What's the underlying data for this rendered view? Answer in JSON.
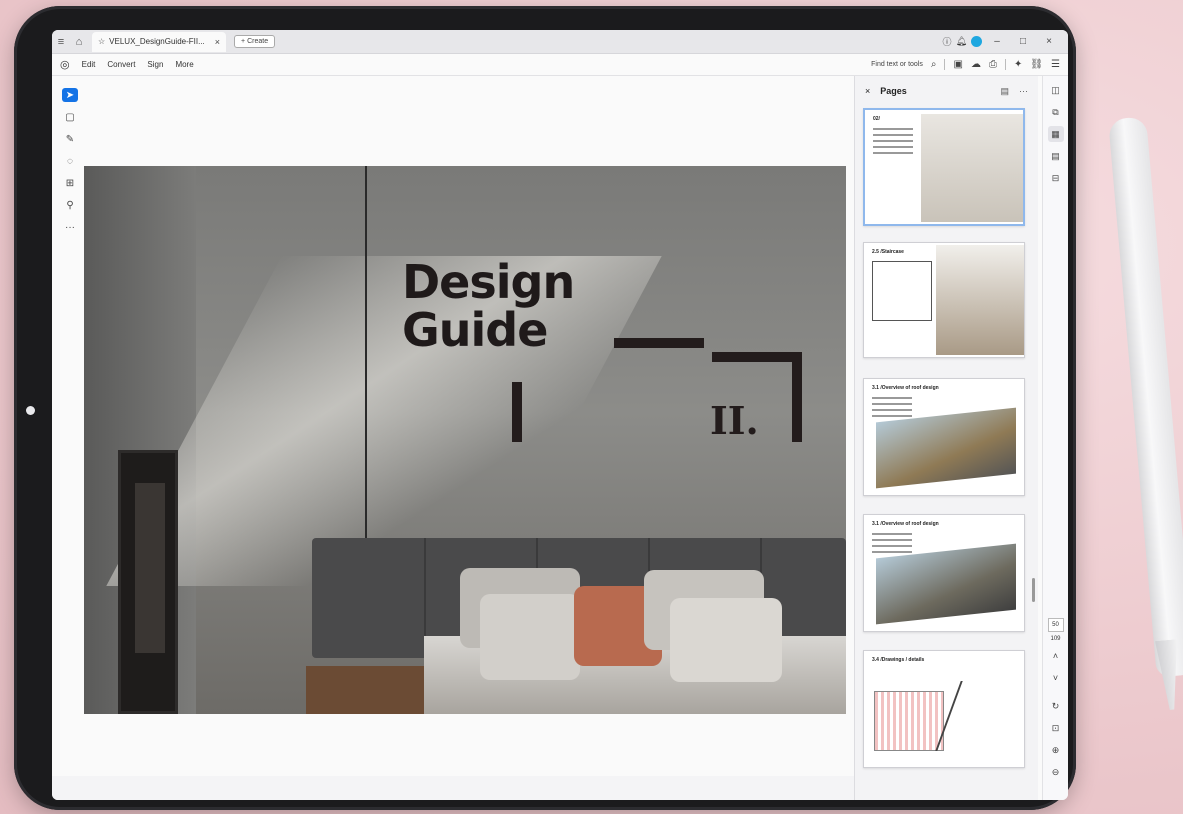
{
  "tabbar": {
    "tab_title": "VELUX_DesignGuide-FII...",
    "close_glyph": "×",
    "create_label": "+ Create",
    "window_controls": [
      "–",
      "□",
      "×"
    ]
  },
  "menubar": {
    "items": [
      "Edit",
      "Convert",
      "Sign",
      "More"
    ],
    "find_placeholder": "Find text or tools"
  },
  "document": {
    "heading_line1": "Design",
    "heading_line2": "Guide",
    "roman_numeral": "II."
  },
  "pages_panel": {
    "title": "Pages",
    "close_glyph": "×",
    "more_glyph": "···",
    "thumbnails": [
      {
        "title": "02/",
        "accent": "#2b2b2b"
      },
      {
        "title": "2.5 /Staircase",
        "accent": "#2b2b2b"
      },
      {
        "title": "3.1 /Overview of roof design",
        "accent": "#e04a4a"
      },
      {
        "title": "3.1 /Overview of roof design",
        "accent": "#e04a4a"
      },
      {
        "title": "3.4 /Drawings / details",
        "accent": "#e04a4a"
      }
    ]
  },
  "page_nav": {
    "current_page": "50",
    "total_pages": "109"
  },
  "colors": {
    "accent_blue": "#1473e6",
    "avatar": "#1ea7e0"
  }
}
